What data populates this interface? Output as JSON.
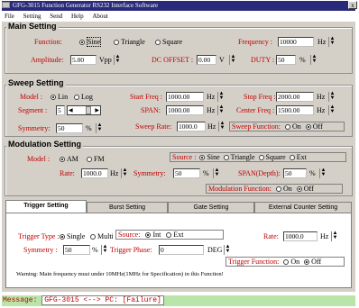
{
  "window": {
    "title": "GFG-3015 Function Generator RS232 Interface Software",
    "close_label": "x"
  },
  "menu": [
    "File",
    "Setting",
    "Send",
    "Help",
    "About"
  ],
  "main": {
    "title": "Main Setting",
    "function_label": "Function:",
    "function_options": [
      "Sine",
      "Triangle",
      "Square"
    ],
    "frequency_label": "Frequency :",
    "frequency_value": "10000",
    "frequency_unit": "Hz",
    "amplitude_label": "Amplitude:",
    "amplitude_value": "5.00",
    "amplitude_unit": "Vpp",
    "offset_label": "DC OFFSET :",
    "offset_value": "0.00",
    "offset_unit": "V",
    "duty_label": "DUTY :",
    "duty_value": "50",
    "duty_unit": "%"
  },
  "sweep": {
    "title": "Sweep Setting",
    "model_label": "Model :",
    "model_options": [
      "Lin",
      "Log"
    ],
    "start_label": "Start Freq :",
    "start_value": "1000.00",
    "start_unit": "Hz",
    "stop_label": "Stop Freq :",
    "stop_value": "2000.00",
    "stop_unit": "Hz",
    "segment_label": "Segment :",
    "segment_value": "5",
    "span_label": "SPAN:",
    "span_value": "1000.00",
    "span_unit": "Hz",
    "center_label": "Center Freq :",
    "center_value": "1500.00",
    "center_unit": "Hz",
    "symmetry_label": "Symmetry:",
    "symmetry_value": "50",
    "symmetry_unit": "%",
    "rate_label": "Sweep Rate:",
    "rate_value": "1000.0",
    "rate_unit": "Hz",
    "function_label": "Sweep Function:",
    "onoff": [
      "On",
      "Off"
    ]
  },
  "modulation": {
    "title": "Modulation Setting",
    "model_label": "Model :",
    "model_options": [
      "AM",
      "FM"
    ],
    "source_label": "Source :",
    "source_options": [
      "Sine",
      "Triangle",
      "Square",
      "Ext"
    ],
    "rate_label": "Rate:",
    "rate_value": "1000.0",
    "rate_unit": "Hz",
    "symmetry_label": "Symmetry:",
    "symmetry_value": "50",
    "symmetry_unit": "%",
    "span_label": "SPAN(Depth):",
    "span_value": "50",
    "span_unit": "%",
    "function_label": "Modulation Function:",
    "onoff": [
      "On",
      "Off"
    ]
  },
  "tabs": [
    "Trigger Setting",
    "Burst Setting",
    "Gate Setting",
    "External Counter Setting"
  ],
  "trigger": {
    "type_label": "Trigger Type :",
    "type_options": [
      "Single",
      "Multi"
    ],
    "source_label": "Source:",
    "source_options": [
      "Int",
      "Ext"
    ],
    "rate_label": "Rate:",
    "rate_value": "1000.0",
    "rate_unit": "Hz",
    "symmetry_label": "Symmetry :",
    "symmetry_value": "50",
    "symmetry_unit": "%",
    "phase_label": "Trigger Phase:",
    "phase_value": "0",
    "phase_unit": "DEG",
    "function_label": "Trigger Function:",
    "onoff": [
      "On",
      "Off"
    ],
    "warning": "Warning: Main frequency must under 10MHz(1MHz for Specification) in this Function!"
  },
  "status": {
    "label": "Message:",
    "value": "GFG-3015 <--> PC: [Failure]"
  }
}
